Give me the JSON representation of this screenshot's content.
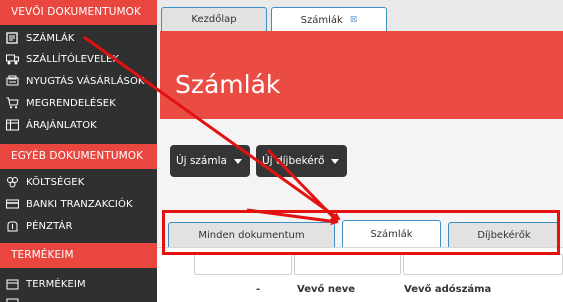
{
  "sidebar": {
    "sections": [
      {
        "header": "VEVŐI DOKUMENTUMOK",
        "items": [
          {
            "label": "SZÁMLÁK",
            "icon": "invoice-icon"
          },
          {
            "label": "SZÁLLÍTÓLEVELEK",
            "icon": "truck-icon"
          },
          {
            "label": "NYUGTÁS VÁSÁRLÁSOK",
            "icon": "receipt-icon"
          },
          {
            "label": "MEGRENDELÉSEK",
            "icon": "cart-icon"
          },
          {
            "label": "ÁRAJÁNLATOK",
            "icon": "quote-icon"
          }
        ]
      },
      {
        "header": "EGYÉB DOKUMENTUMOK",
        "items": [
          {
            "label": "KÖLTSÉGEK",
            "icon": "costs-icon"
          },
          {
            "label": "BANKI TRANZAKCIÓK",
            "icon": "bank-icon"
          },
          {
            "label": "PÉNZTÁR",
            "icon": "cash-register-icon"
          }
        ]
      },
      {
        "header": "TERMÉKEIM",
        "items": [
          {
            "label": "TERMÉKEIM",
            "icon": "product-icon"
          },
          {
            "label": "",
            "icon": "product-list-icon"
          }
        ]
      }
    ]
  },
  "tabs": [
    {
      "label": "Kezdőlap",
      "active": false
    },
    {
      "label": "Számlák",
      "active": true,
      "close": "⊠"
    }
  ],
  "page": {
    "title": "Számlák"
  },
  "actions": {
    "new_invoice": "Új számla",
    "new_request": "Új díjbekérő"
  },
  "doc_tabs": [
    {
      "label": "Minden dokumentum",
      "active": false
    },
    {
      "label": "Számlák",
      "active": true
    },
    {
      "label": "Díjbekérők",
      "active": false
    }
  ],
  "table": {
    "columns": [
      "-",
      "Vevő neve",
      "Vevő adószáma"
    ]
  },
  "colors": {
    "accent_red": "#e8463f",
    "sidebar_bg": "#303030",
    "tab_border": "#3b8fc7",
    "annotation_red": "#e41111"
  }
}
